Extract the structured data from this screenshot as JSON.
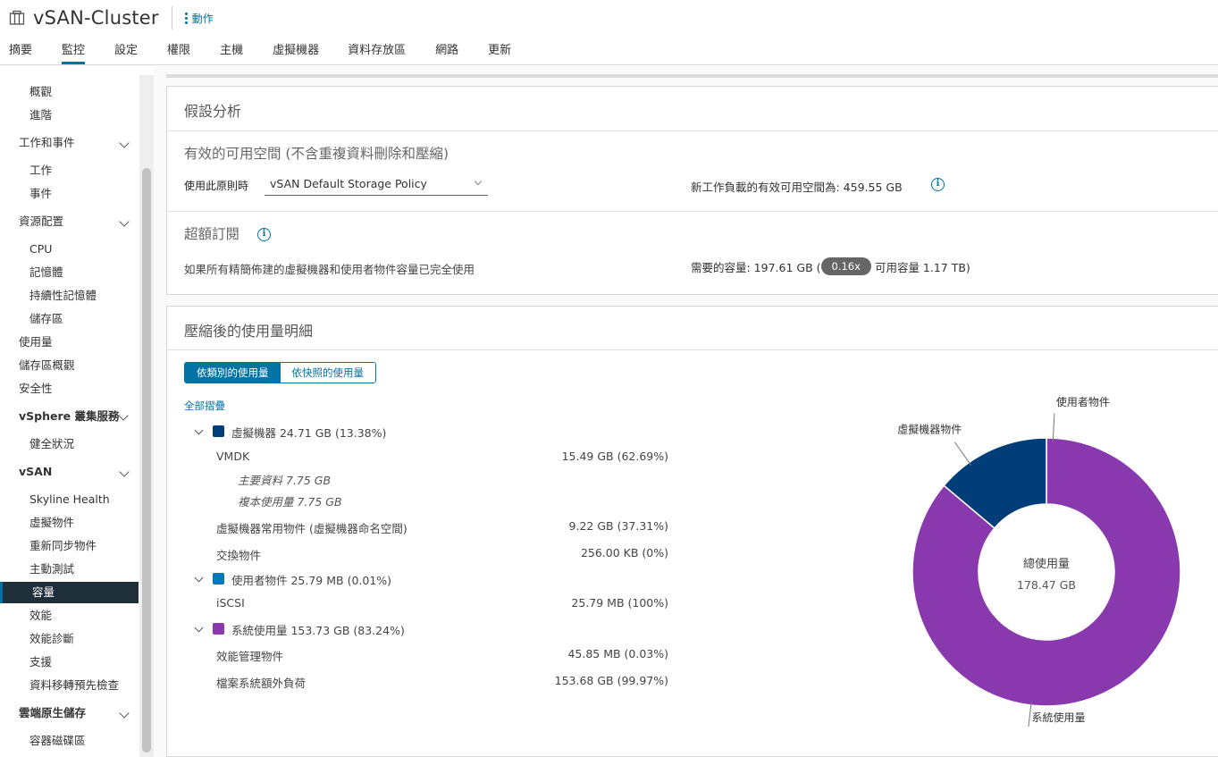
{
  "header": {
    "title": "vSAN-Cluster",
    "actions_label": "動作",
    "tabs": [
      "摘要",
      "監控",
      "設定",
      "權限",
      "主機",
      "虛擬機器",
      "資料存放區",
      "網路",
      "更新"
    ],
    "active_tab": "監控"
  },
  "sidebar": {
    "items": [
      {
        "label": "概觀"
      },
      {
        "label": "進階"
      },
      {
        "label": "工作和事件"
      },
      {
        "label": "工作"
      },
      {
        "label": "事件"
      },
      {
        "label": "資源配置"
      },
      {
        "label": "CPU"
      },
      {
        "label": "記憶體"
      },
      {
        "label": "持續性記憶體"
      },
      {
        "label": "儲存區"
      },
      {
        "label": "使用量"
      },
      {
        "label": "儲存區概觀"
      },
      {
        "label": "安全性"
      },
      {
        "label": "vSphere 叢集服務"
      },
      {
        "label": "健全狀況"
      },
      {
        "label": "vSAN"
      },
      {
        "label": "Skyline Health"
      },
      {
        "label": "虛擬物件"
      },
      {
        "label": "重新同步物件"
      },
      {
        "label": "主動測試"
      },
      {
        "label": "容量"
      },
      {
        "label": "效能"
      },
      {
        "label": "效能診斷"
      },
      {
        "label": "支援"
      },
      {
        "label": "資料移轉預先檢查"
      },
      {
        "label": "雲端原生儲存"
      },
      {
        "label": "容器磁碟區"
      }
    ]
  },
  "whatif": {
    "title": "假設分析",
    "effective_title": "有效的可用空間 (不含重複資料刪除和壓縮)",
    "policy_label": "使用此原則時",
    "policy_value": "vSAN Default Storage Policy",
    "effective_text": "新工作負載的有效可用空間為: 459.55 GB",
    "oversub_title": "超額訂閱",
    "oversub_desc": "如果所有精簡佈建的虛擬機器和使用者物件容量已完全使用",
    "required_prefix": "需要的容量: 197.61 GB (",
    "ratio": "0.16x",
    "available_suffix": "可用容量 1.17 TB)"
  },
  "breakdown": {
    "title": "壓縮後的使用量明細",
    "toggle_on": "依類別的使用量",
    "toggle_off": "依快照的使用量",
    "collapse_all": "全部摺疊",
    "groups": {
      "vm": {
        "label": "虛擬機器 24.71 GB (13.38%)",
        "color": "#003d79"
      },
      "user": {
        "label": "使用者物件 25.79 MB (0.01%)",
        "color": "#0079b8"
      },
      "system": {
        "label": "系統使用量 153.73 GB (83.24%)",
        "color": "#8939ad"
      }
    },
    "rows": {
      "vmdk": {
        "name": "VMDK",
        "value": "15.49 GB (62.69%)"
      },
      "primary": "主要資料  7.75 GB",
      "replica": "複本使用量  7.75 GB",
      "vm_home": {
        "name": "虛擬機器常用物件 (虛擬機器命名空間)",
        "value": "9.22 GB (37.31%)"
      },
      "swap": {
        "name": "交換物件",
        "value": "256.00 KB (0%)"
      },
      "iscsi": {
        "name": "iSCSI",
        "value": "25.79 MB (100%)"
      },
      "perf": {
        "name": "效能管理物件",
        "value": "45.85 MB (0.03%)"
      },
      "fs": {
        "name": "檔案系統額外負荷",
        "value": "153.68 GB (99.97%)"
      }
    }
  },
  "chart_data": {
    "type": "pie",
    "title": "",
    "center_label": "總使用量",
    "center_value": "178.47 GB",
    "slices": [
      {
        "label": "虛擬機器物件",
        "value": 24.71,
        "color": "#003d79"
      },
      {
        "label": "使用者物件",
        "value": 0.025,
        "color": "#0079b8"
      },
      {
        "label": "系統使用量",
        "value": 153.73,
        "color": "#8939ad"
      }
    ]
  }
}
